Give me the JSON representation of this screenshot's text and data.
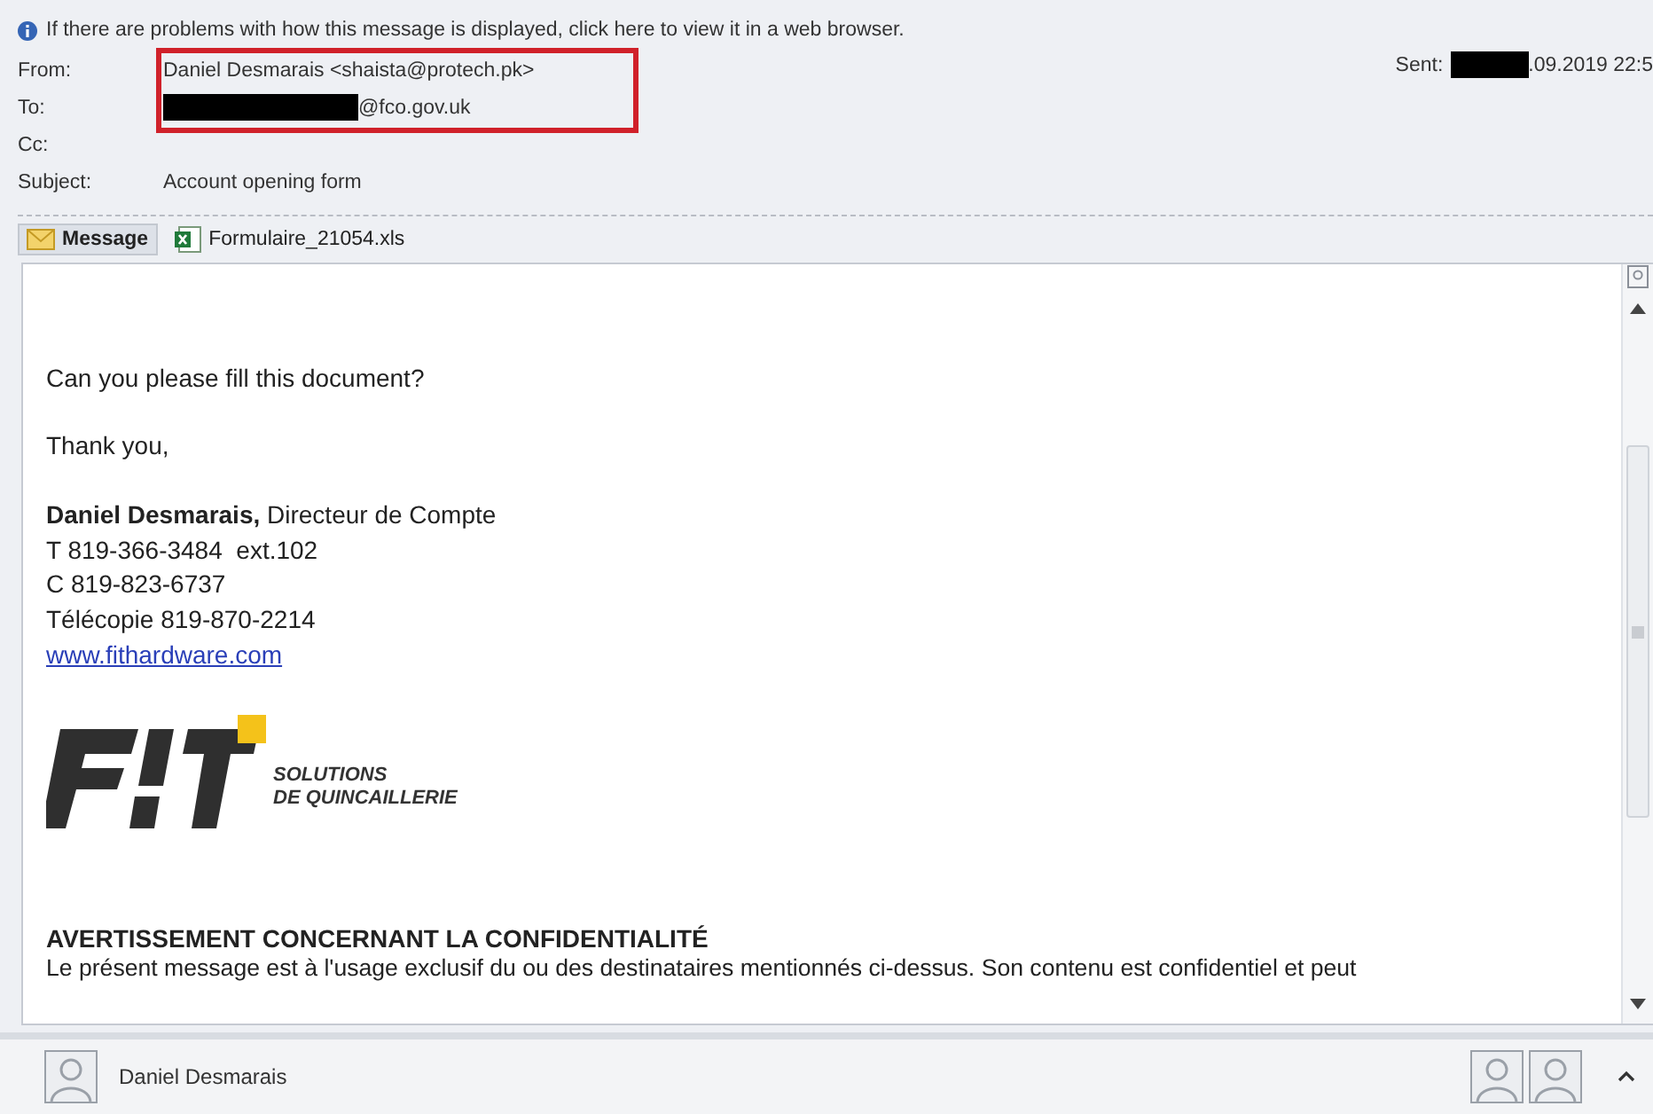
{
  "info_bar": {
    "text": "If there are problems with how this message is displayed, click here to view it in a web browser."
  },
  "header": {
    "fields": [
      {
        "label": "From:",
        "value": "Daniel Desmarais <shaista@protech.pk>",
        "highlighted": true
      },
      {
        "label": "To:",
        "value": "@fco.gov.uk",
        "redacted": true,
        "highlighted": true
      },
      {
        "label": "Cc:"
      },
      {
        "label": "Subject:",
        "value": "Account opening form"
      }
    ],
    "sent": {
      "label": "Sent:",
      "value": ".09.2019 22:5",
      "redacted": true
    }
  },
  "tabs": [
    {
      "label": "Message",
      "kind": "message",
      "selected": true
    },
    {
      "label": "Formulaire_21054.xls",
      "kind": "attachment",
      "selected": false
    }
  ],
  "body": [
    {
      "kind": "text",
      "text": "Can you please fill this document?"
    },
    {
      "kind": "text",
      "text": "Thank you,"
    },
    {
      "kind": "signature",
      "lines": [
        "**Daniel Desmarais,** Directeur de Compte",
        "T 819-366-3484  ext.102",
        "C 819-823-6737",
        "Télécopie 819-870-2214"
      ]
    },
    {
      "kind": "link",
      "text": "www.fithardware.com"
    },
    {
      "kind": "logo",
      "lines": [
        "SOLUTIONS",
        "DE QUINCAILLERIE"
      ]
    },
    {
      "kind": "heading",
      "text": "AVERTISSEMENT CONCERNANT LA CONFIDENTIALITÉ"
    },
    {
      "kind": "text",
      "text": "Le présent message est à l'usage exclusif du ou des destinataires mentionnés ci-dessus. Son contenu est confidentiel et peut"
    }
  ],
  "people_pane": {
    "name": "Daniel Desmarais"
  }
}
